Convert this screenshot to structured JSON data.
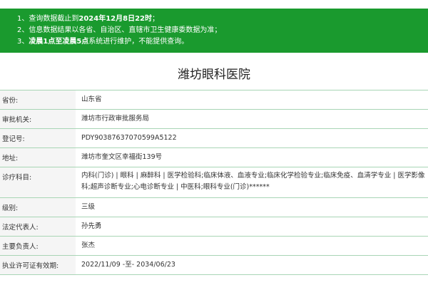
{
  "notice": {
    "line1_prefix": "1、查询数据截止到",
    "line1_bold": "2024年12月8日22时",
    "line1_suffix": "；",
    "line2": "2、信息数据结果以各省、自治区、直辖市卫生健康委数据为准；",
    "line3_prefix": "3、",
    "line3_bold": "凌晨1点至凌晨5点",
    "line3_suffix": "系统进行维护，不能提供查询。"
  },
  "hospital_name": "潍坊眼科医院",
  "details": [
    {
      "label": "省份:",
      "value": "山东省"
    },
    {
      "label": "审批机关:",
      "value": "潍坊市行政审批服务局"
    },
    {
      "label": "登记号:",
      "value": "PDY90387637070599A5122"
    },
    {
      "label": "地址:",
      "value": "潍坊市奎文区幸福街139号"
    },
    {
      "label": "诊疗科目:",
      "value": "内科(门诊) | 眼科 | 麻醉科 | 医学检验科;临床体液、血液专业;临床化学检验专业;临床免疫、血清学专业 | 医学影像科;超声诊断专业;心电诊断专业 | 中医科;眼科专业(门诊)******"
    },
    {
      "label": "级别:",
      "value": "三级"
    },
    {
      "label": "法定代表人:",
      "value": "孙先勇"
    },
    {
      "label": "主要负责人:",
      "value": "张杰"
    },
    {
      "label": "执业许可证有效期:",
      "value": "2022/11/09 -至- 2034/06/23"
    }
  ],
  "colors": {
    "banner": "#1a9a2e",
    "row_border": "#a8d5b5",
    "label_bg": "#f5f5f5"
  }
}
